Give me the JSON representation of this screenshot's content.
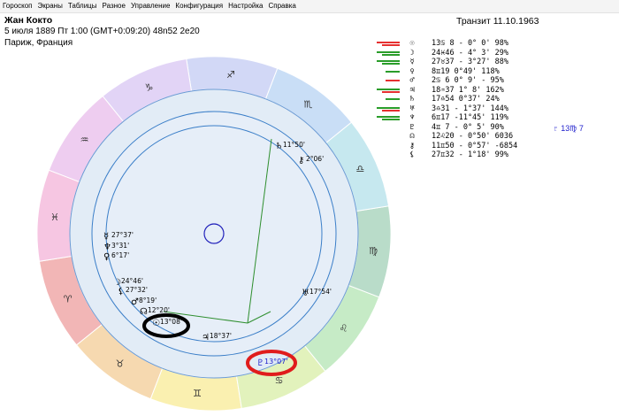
{
  "menu": [
    "Гороскоп",
    "Экраны",
    "Таблицы",
    "Разное",
    "Управление",
    "Конфигурация",
    "Настройка",
    "Справка"
  ],
  "chart_info": {
    "name": "Жан Кокто",
    "datetime": "5 июля 1889  Пт   1:00 (GMT+0:09:20) 48n52  2e20",
    "place": "Париж, Франция",
    "transit": "Транзит 11.10.1963"
  },
  "planet_table": [
    {
      "symbol": "☉",
      "text": "13♋ 8 - 0° 0'  98%",
      "bars": [
        "#e63030",
        "#e63030"
      ]
    },
    {
      "symbol": "☽",
      "text": "24♓46 - 4° 3'  29%",
      "bars": [
        "#2a9d2a",
        "#2a9d2a"
      ]
    },
    {
      "symbol": "☿",
      "text": "27♉37 - 3°27'  88%",
      "bars": [
        "#2a9d2a",
        "#2a9d2a"
      ]
    },
    {
      "symbol": "♀",
      "text": " 8♊19   0°49' 118%",
      "bars": [
        "#2a9d2a"
      ]
    },
    {
      "symbol": "♂",
      "text": " 2♋ 6   0° 9' - 95%",
      "bars": [
        "#e63030"
      ]
    },
    {
      "symbol": "♃",
      "text": "18♒37   1° 8' 162%",
      "bars": [
        "#2a9d2a",
        "#e63030"
      ]
    },
    {
      "symbol": "♄",
      "text": "17♎54   0°37'  24%",
      "bars": [
        "#2a9d2a"
      ]
    },
    {
      "symbol": "♅",
      "text": " 3♎31 - 1°37' 144%",
      "bars": [
        "#2a9d2a",
        "#e63030"
      ]
    },
    {
      "symbol": "♆",
      "text": " 6♊17 -11°45' 119%",
      "bars": [
        "#2a9d2a",
        "#2a9d2a"
      ]
    },
    {
      "symbol": "♇",
      "text": " 4♊ 7 - 0° 5'  90%",
      "bars": []
    },
    {
      "symbol": "☊",
      "text": "12♌20 - 0°50' 6036",
      "bars": []
    },
    {
      "symbol": "⚷",
      "text": "11♊50 - 0°57' -6854",
      "bars": []
    },
    {
      "symbol": "⚸",
      "text": "27♊32 - 1°18'  99%",
      "bars": []
    }
  ],
  "transit_extra": "♇ 13♍ 7",
  "wheel": {
    "signs": [
      {
        "glyph": "♈",
        "color": "#f2b6b6"
      },
      {
        "glyph": "♉",
        "color": "#f6d9b0"
      },
      {
        "glyph": "♊",
        "color": "#faf0b0"
      },
      {
        "glyph": "♋",
        "color": "#e2f2bc"
      },
      {
        "glyph": "♌",
        "color": "#c6ebc6"
      },
      {
        "glyph": "♍",
        "color": "#b9dcc9"
      },
      {
        "glyph": "♎",
        "color": "#c6e8ef"
      },
      {
        "glyph": "♏",
        "color": "#c9def6"
      },
      {
        "glyph": "♐",
        "color": "#d2d8f6"
      },
      {
        "glyph": "♑",
        "color": "#e2d4f6"
      },
      {
        "glyph": "♒",
        "color": "#eecdf0"
      },
      {
        "glyph": "♓",
        "color": "#f6c6e2"
      }
    ],
    "natal_labels": [
      {
        "glyph": "☿",
        "text": "27°37'"
      },
      {
        "glyph": "♆",
        "text": "3°31'"
      },
      {
        "glyph": "♀",
        "text": "6°17'"
      },
      {
        "glyph": "☽",
        "text": "24°46'"
      },
      {
        "glyph": "⚸",
        "text": "27°32'"
      },
      {
        "glyph": "♂",
        "text": "8°19'"
      },
      {
        "glyph": "☊",
        "text": "12°20'"
      },
      {
        "glyph": "☉",
        "text": "13°08'"
      },
      {
        "glyph": "♃",
        "text": "18°37'"
      },
      {
        "glyph": "♅",
        "text": "17°54'"
      },
      {
        "glyph": "♄",
        "text": "11°50'"
      },
      {
        "glyph": "⚷",
        "text": "2°06'"
      }
    ],
    "transit_pluto": {
      "glyph": "♇",
      "text": "13°07'"
    },
    "highlight_colors": {
      "sun": "#000000",
      "pluto": "#e01c1c"
    }
  }
}
